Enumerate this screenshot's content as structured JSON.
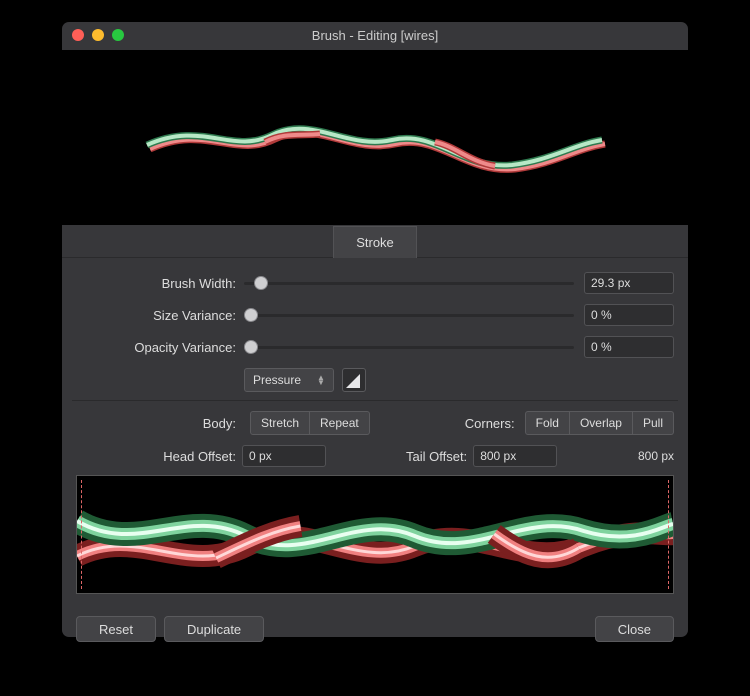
{
  "window": {
    "title": "Brush - Editing [wires]"
  },
  "tab": {
    "stroke": "Stroke"
  },
  "sliders": {
    "brush_width": {
      "label": "Brush Width:",
      "value": "29.3 px",
      "knob_pct": 3
    },
    "size_variance": {
      "label": "Size Variance:",
      "value": "0 %",
      "knob_pct": 0
    },
    "opacity_variance": {
      "label": "Opacity Variance:",
      "value": "0 %",
      "knob_pct": 0
    }
  },
  "dynamics": {
    "selected": "Pressure"
  },
  "body": {
    "label": "Body:",
    "options": [
      "Stretch",
      "Repeat"
    ]
  },
  "corners": {
    "label": "Corners:",
    "options": [
      "Fold",
      "Overlap",
      "Pull"
    ]
  },
  "offsets": {
    "head": {
      "label": "Head Offset:",
      "value": "0 px"
    },
    "tail": {
      "label": "Tail Offset:",
      "value": "800 px",
      "readout": "800 px"
    }
  },
  "footer": {
    "reset": "Reset",
    "duplicate": "Duplicate",
    "close": "Close"
  }
}
